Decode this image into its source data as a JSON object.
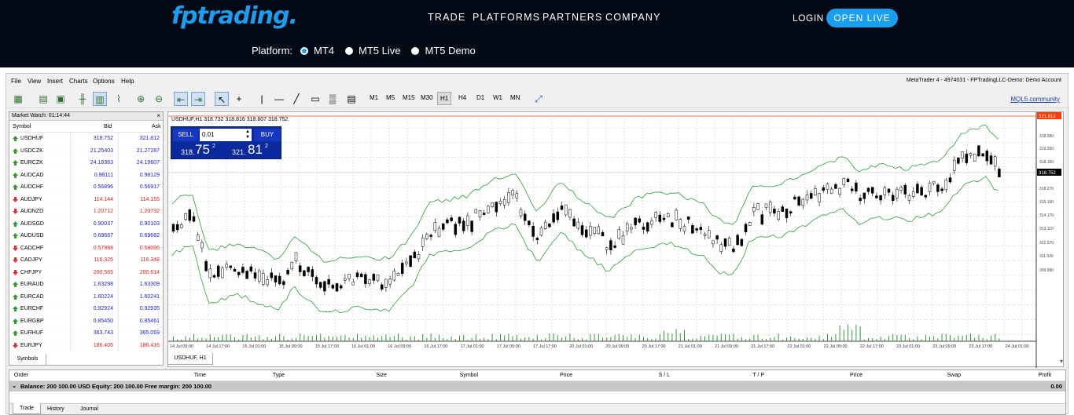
{
  "header": {
    "logo": "fptrading.",
    "nav": [
      "TRADE",
      "PLATFORMS",
      "PARTNERS",
      "COMPANY"
    ],
    "login": "LOGIN",
    "open_live": "OPEN LIVE",
    "platform_label": "Platform:",
    "platforms": [
      "MT4",
      "MT5 Live",
      "MT5 Demo"
    ],
    "platform_selected": "MT4"
  },
  "terminal": {
    "menu": [
      "File",
      "View",
      "Insert",
      "Charts",
      "Options",
      "Help"
    ],
    "account_title": "MetaTrader 4 - 4974031 - FPTradingLLC-Demo: Demo Account",
    "timeframes": [
      "M1",
      "M5",
      "M15",
      "M30",
      "H1",
      "H4",
      "D1",
      "W1",
      "MN"
    ],
    "timeframe_selected": "H1",
    "mql5_link": "MQL5.community"
  },
  "market_watch": {
    "title": "Market Watch: 01:14:44",
    "columns": [
      "Symbol",
      "Bid",
      "Ask"
    ],
    "tab": "Symbols",
    "rows": [
      {
        "symbol": "USDHUF",
        "bid": "318.752",
        "ask": "321.812",
        "dir": "up"
      },
      {
        "symbol": "USDCZK",
        "bid": "21.25403",
        "ask": "21.27287",
        "dir": "up"
      },
      {
        "symbol": "EURCZK",
        "bid": "24.18363",
        "ask": "24.19607",
        "dir": "up"
      },
      {
        "symbol": "AUDCAD",
        "bid": "0.98111",
        "ask": "0.98129",
        "dir": "up"
      },
      {
        "symbol": "AUDCHF",
        "bid": "0.56896",
        "ask": "0.56917",
        "dir": "up"
      },
      {
        "symbol": "AUDJPY",
        "bid": "114.144",
        "ask": "114.155",
        "dir": "down"
      },
      {
        "symbol": "AUDNZD",
        "bid": "1.20712",
        "ask": "1.20732",
        "dir": "down"
      },
      {
        "symbol": "AUDSGD",
        "bid": "0.90037",
        "ask": "0.90103",
        "dir": "up"
      },
      {
        "symbol": "AUDUSD",
        "bid": "0.69667",
        "ask": "0.69682",
        "dir": "up"
      },
      {
        "symbol": "CADCHF",
        "bid": "0.57988",
        "ask": "0.58006",
        "dir": "down"
      },
      {
        "symbol": "CADJPY",
        "bid": "116.325",
        "ask": "116.348",
        "dir": "down"
      },
      {
        "symbol": "CHFJPY",
        "bid": "200.565",
        "ask": "200.614",
        "dir": "down"
      },
      {
        "symbol": "EURAUD",
        "bid": "1.63298",
        "ask": "1.63309",
        "dir": "up"
      },
      {
        "symbol": "EURCAD",
        "bid": "1.60224",
        "ask": "1.60241",
        "dir": "up"
      },
      {
        "symbol": "EURCHF",
        "bid": "0.92924",
        "ask": "0.92935",
        "dir": "up"
      },
      {
        "symbol": "EURGBP",
        "bid": "0.85450",
        "ask": "0.85461",
        "dir": "up"
      },
      {
        "symbol": "EURHUF",
        "bid": "363.743",
        "ask": "365.059",
        "dir": "up"
      },
      {
        "symbol": "EURJPY",
        "bid": "186.405",
        "ask": "186.416",
        "dir": "down"
      }
    ]
  },
  "chart": {
    "info": "USDHUF,H1  318.732 318.816 318.607 318.752",
    "tab": "USDHUF, H1",
    "sell_label": "SELL",
    "buy_label": "BUY",
    "lot": "0.01",
    "sell_small": "318.",
    "sell_big": "75",
    "sell_sup": "2",
    "buy_small": "321.",
    "buy_big": "81",
    "buy_sup": "2",
    "ask_tag": "321.812",
    "bid_tag": "318.752"
  },
  "chart_data": {
    "type": "candlestick",
    "symbol": "USDHUF",
    "timeframe": "H1",
    "y_ticks": [
      "318.390",
      "319.350",
      "318.160",
      "318.270",
      "315.160",
      "314.170",
      "313.110",
      "312.070",
      "311.030",
      "309.990"
    ],
    "x_ticks": [
      "14 Jul 09:00",
      "14 Jul 17:00",
      "15 Jul 01:00",
      "15 Jul 09:00",
      "15 Jul 17:00",
      "16 Jul 01:00",
      "16 Jul 09:00",
      "16 Jul 17:00",
      "17 Jul 01:00",
      "17 Jul 09:00",
      "17 Jul 17:00",
      "20 Jul 01:00",
      "20 Jul 09:00",
      "20 Jul 17:00",
      "21 Jul 01:00",
      "21 Jul 09:00",
      "21 Jul 17:00",
      "22 Jul 01:00",
      "22 Jul 09:00",
      "22 Jul 17:00",
      "23 Jul 01:00",
      "23 Jul 09:00",
      "23 Jul 17:00",
      "24 Jul 01:00"
    ],
    "indicator": "Bollinger Bands",
    "colors": {
      "candle": "#000000",
      "bands": "#2a9d3a",
      "volume": "#2a9d3a",
      "ask_line": "#ff3b00"
    }
  },
  "orders": {
    "columns": [
      "Order",
      "Time",
      "Type",
      "Size",
      "Symbol",
      "Price",
      "S / L",
      "T / P",
      "Price",
      "Swap",
      "Profit"
    ],
    "balance_line": "Balance: 200 100.00 USD  Equity: 200 100.00  Free margin: 200 100.00",
    "profit": "0.00",
    "tabs": [
      "Trade",
      "History",
      "Journal"
    ]
  }
}
